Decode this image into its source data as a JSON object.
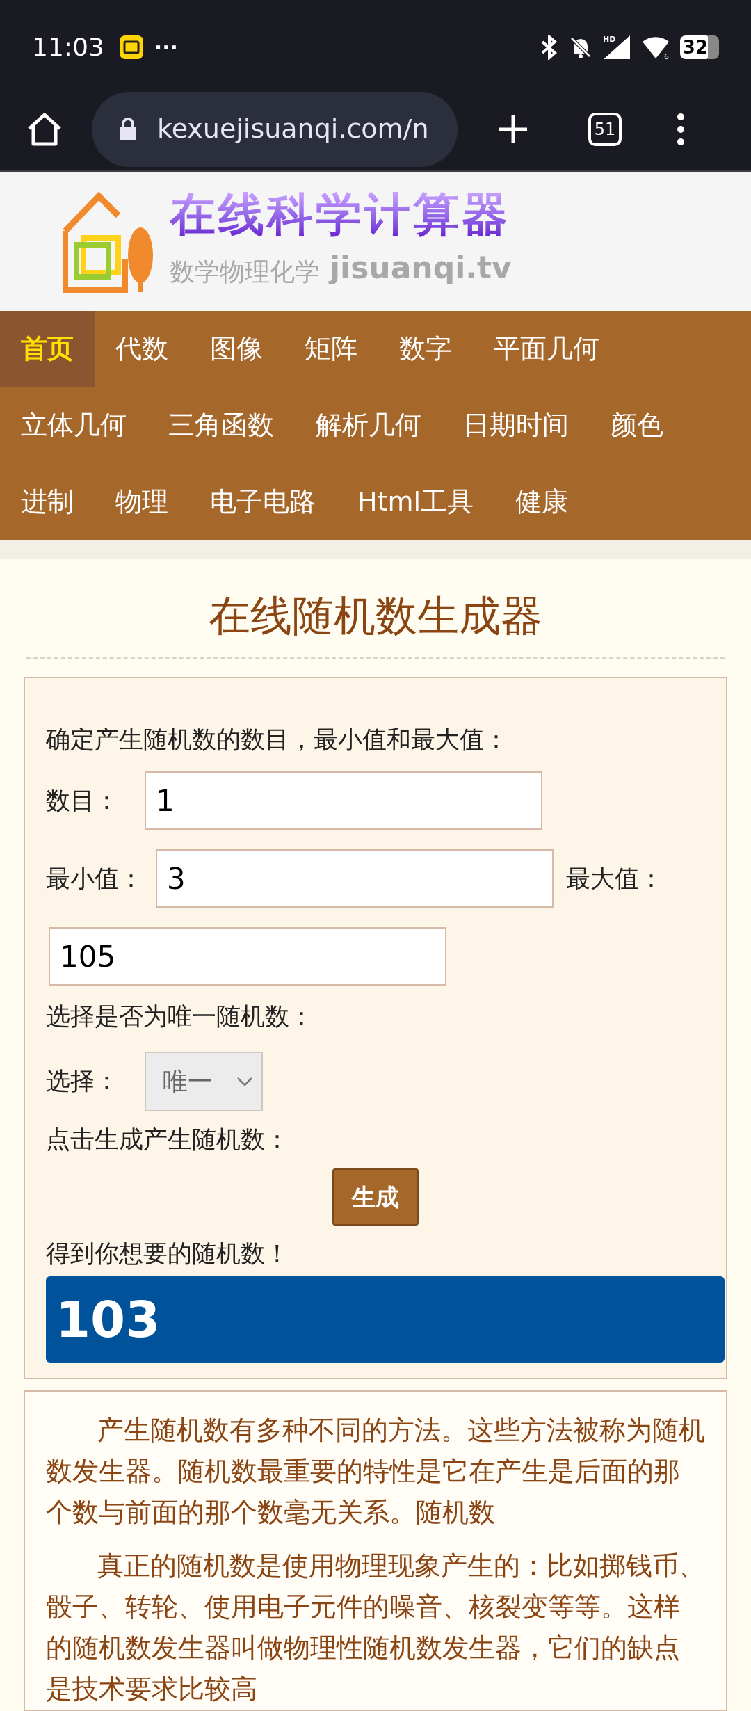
{
  "status_bar": {
    "time": "11:03",
    "more": "···",
    "network": "HD",
    "wifi_band": "6",
    "battery": "32"
  },
  "browser": {
    "url": "kexuejisuanqi.com/n",
    "tab_count": "51"
  },
  "logo": {
    "title": "在线科学计算器",
    "subtitle": "数学物理化学",
    "domain": "jisuanqi.tv"
  },
  "nav": {
    "items": [
      {
        "label": "首页",
        "selected": true
      },
      {
        "label": "代数",
        "selected": false
      },
      {
        "label": "图像",
        "selected": false
      },
      {
        "label": "矩阵",
        "selected": false
      },
      {
        "label": "数字",
        "selected": false
      },
      {
        "label": "平面几何",
        "selected": false
      },
      {
        "label": "立体几何",
        "selected": false
      },
      {
        "label": "三角函数",
        "selected": false
      },
      {
        "label": "解析几何",
        "selected": false
      },
      {
        "label": "日期时间",
        "selected": false
      },
      {
        "label": "颜色",
        "selected": false
      },
      {
        "label": "进制",
        "selected": false
      },
      {
        "label": "物理",
        "selected": false
      },
      {
        "label": "电子电路",
        "selected": false
      },
      {
        "label": "Html工具",
        "selected": false
      },
      {
        "label": "健康",
        "selected": false
      }
    ]
  },
  "page_title": "在线随机数生成器",
  "form": {
    "intro": "确定产生随机数的数目，最小值和最大值：",
    "count": {
      "label": "数目：",
      "value": "1"
    },
    "min": {
      "label": "最小值：",
      "value": "3"
    },
    "max": {
      "label": "最大值：",
      "value": "105"
    },
    "unique_prompt": "选择是否为唯一随机数：",
    "choice": {
      "label": "选择：",
      "value": "唯一",
      "disabled": true
    },
    "generate_prompt": "点击生成产生随机数：",
    "generate_button": "生成",
    "result_prompt": "得到你想要的随机数！",
    "result": "103"
  },
  "description": [
    "产生随机数有多种不同的方法。这些方法被称为随机数发生器。随机数最重要的特性是它在产生是后面的那个数与前面的那个数毫无关系。随机数",
    "真正的随机数是使用物理现象产生的：比如掷钱币、骰子、转轮、使用电子元件的噪音、核裂变等等。这样的随机数发生器叫做物理性随机数发生器，它们的缺点是技术要求比较高"
  ]
}
